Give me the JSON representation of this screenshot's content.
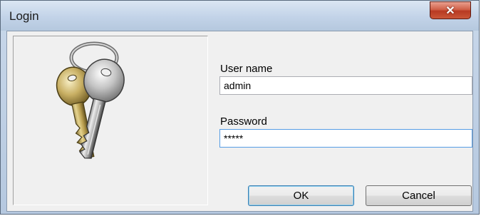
{
  "window": {
    "title": "Login",
    "close_label": "✕"
  },
  "picture": {
    "icon": "keys-icon"
  },
  "form": {
    "username_label": "User name",
    "username_value": "admin",
    "password_label": "Password",
    "password_value": "*****"
  },
  "buttons": {
    "ok_label": "OK",
    "cancel_label": "Cancel"
  },
  "colors": {
    "close_button": "#c9472e",
    "focus_border": "#569de5",
    "titlebar": "#c2d3e8"
  }
}
